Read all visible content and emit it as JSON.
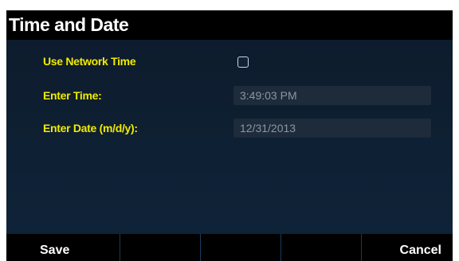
{
  "header": {
    "title": "Time and Date"
  },
  "form": {
    "network_time_label": "Use Network Time",
    "network_time_checked": false,
    "time_label": "Enter Time:",
    "time_value": "3:49:03 PM",
    "date_label": "Enter Date (m/d/y):",
    "date_value": "12/31/2013"
  },
  "softkeys": {
    "key1": "Save",
    "key2": "",
    "key3": "",
    "key4": "",
    "key5": "Cancel"
  },
  "colors": {
    "label": "#f2ea00",
    "background": "#0d1a29",
    "bar": "#000000"
  }
}
